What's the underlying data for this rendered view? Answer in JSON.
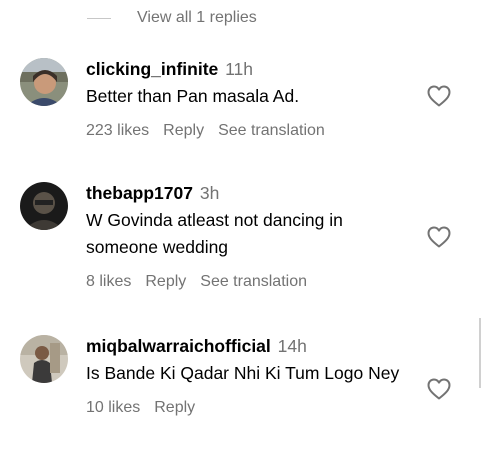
{
  "view_replies": "View all 1 replies",
  "comments": [
    {
      "username": "clicking_infinite",
      "time": "11h",
      "text": "Better than Pan masala Ad.",
      "likes": "223 likes",
      "reply": "Reply",
      "translation": "See translation",
      "avatar_icon": "user-avatar"
    },
    {
      "username": "thebapp1707",
      "time": "3h",
      "text": "W Govinda atleast not dancing in someone wedding",
      "likes": "8 likes",
      "reply": "Reply",
      "translation": "See translation",
      "avatar_icon": "user-avatar"
    },
    {
      "username": "miqbalwarraichofficial",
      "time": "14h",
      "text": "Is Bande Ki Qadar Nhi Ki Tum Logo Ney",
      "likes": "10 likes",
      "reply": "Reply",
      "avatar_icon": "user-avatar"
    }
  ],
  "icons": {
    "like": "heart-outline-icon"
  },
  "colors": {
    "text": "#000000",
    "secondary": "#737373",
    "divider": "#c7c7c7"
  }
}
